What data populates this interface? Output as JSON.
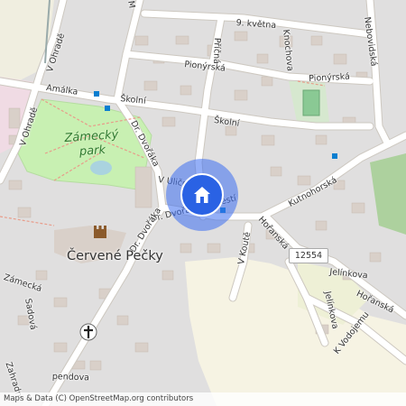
{
  "map": {
    "streets": {
      "9_kvetna": "9. května",
      "nebovidska": "Nebovidská",
      "v_ohrade_top": "V Ohradě",
      "amalka": "Amálka",
      "pionyrska_1": "Pionýrská",
      "pionyrska_2": "Pionýrská",
      "pricna": "Příčná",
      "knochova": "Knochova",
      "skolni_1": "Školní",
      "skolni_2": "Školní",
      "dr_dvoraka_1": "Dr. Dvořáka",
      "dr_dvoraka_2": "Dr. Dvořáka",
      "v_ohrade_left": "V Ohradě",
      "v_ulicce": "V Uličce",
      "dr_dvoraka_namesti": "Dr. Dvořáka náměstí",
      "kutnohorska": "Kutnohorská",
      "horanska_1": "Hořanská",
      "horanska_2": "Hořanská",
      "v_koute": "V Koutě",
      "zamecka": "Zámecká",
      "sadova": "Sadová",
      "jelinkova_1": "Jelínkova",
      "jelinkova_2": "Jelínkova",
      "k_vodojemu": "K Vodojemu",
      "zahradni_partial": "Zahradní",
      "pendova_partial": "pendova",
      "m_partial": "M"
    },
    "park_name": "Zámecký park",
    "town_name": "Červené Pečky",
    "road_shield": "12554",
    "attribution": "Maps & Data (C) OpenStreetMap.org contributors",
    "pin_icon": "home-icon",
    "colors": {
      "background": "#f2efe9",
      "park": "#c8f0b2",
      "forest": "#add19e",
      "residential": "#e0dfdf",
      "road": "#ffffff",
      "road_casing": "#d2cdc5",
      "pin": "#2a62e4",
      "halo": "#3c6ef0"
    }
  }
}
